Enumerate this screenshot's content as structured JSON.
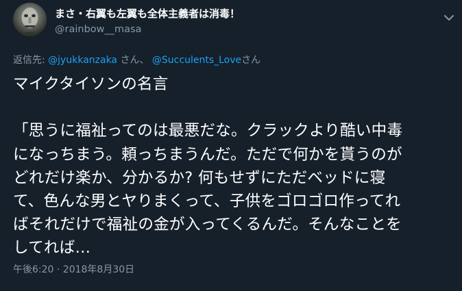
{
  "author": {
    "display_name": "まさ・右翼も左翼も全体主義者は消毒！",
    "handle": "@rainbow__masa"
  },
  "reply": {
    "prefix": "返信先: ",
    "to_1": "@jyukkanzaka",
    "sep_1": " さん、 ",
    "to_2": "@Succulents_Love",
    "sep_2": "さん"
  },
  "tweet": {
    "lines": [
      "マイクタイソンの名言",
      "",
      "「思うに福祉ってのは最悪だな。クラックより酷い中毒",
      "になっちまう。頼っちまうんだ。ただで何かを貰うのが",
      "どれだけ楽か、分かるか? 何もせずにただベッドに寝",
      "て、色んな男とヤりまくって、子供をゴロゴロ作ってれ",
      "ばそれだけで福祉の金が入ってくるんだ。そんなことを",
      "してれば…"
    ]
  },
  "timestamp": "午後6:20 · 2018年8月30日",
  "icons": {
    "avatar": "avatar",
    "menu": "chevron-down-icon"
  },
  "colors": {
    "background": "#15202b",
    "text": "#ffffff",
    "secondary": "#8899a6",
    "link": "#1da1f2"
  }
}
